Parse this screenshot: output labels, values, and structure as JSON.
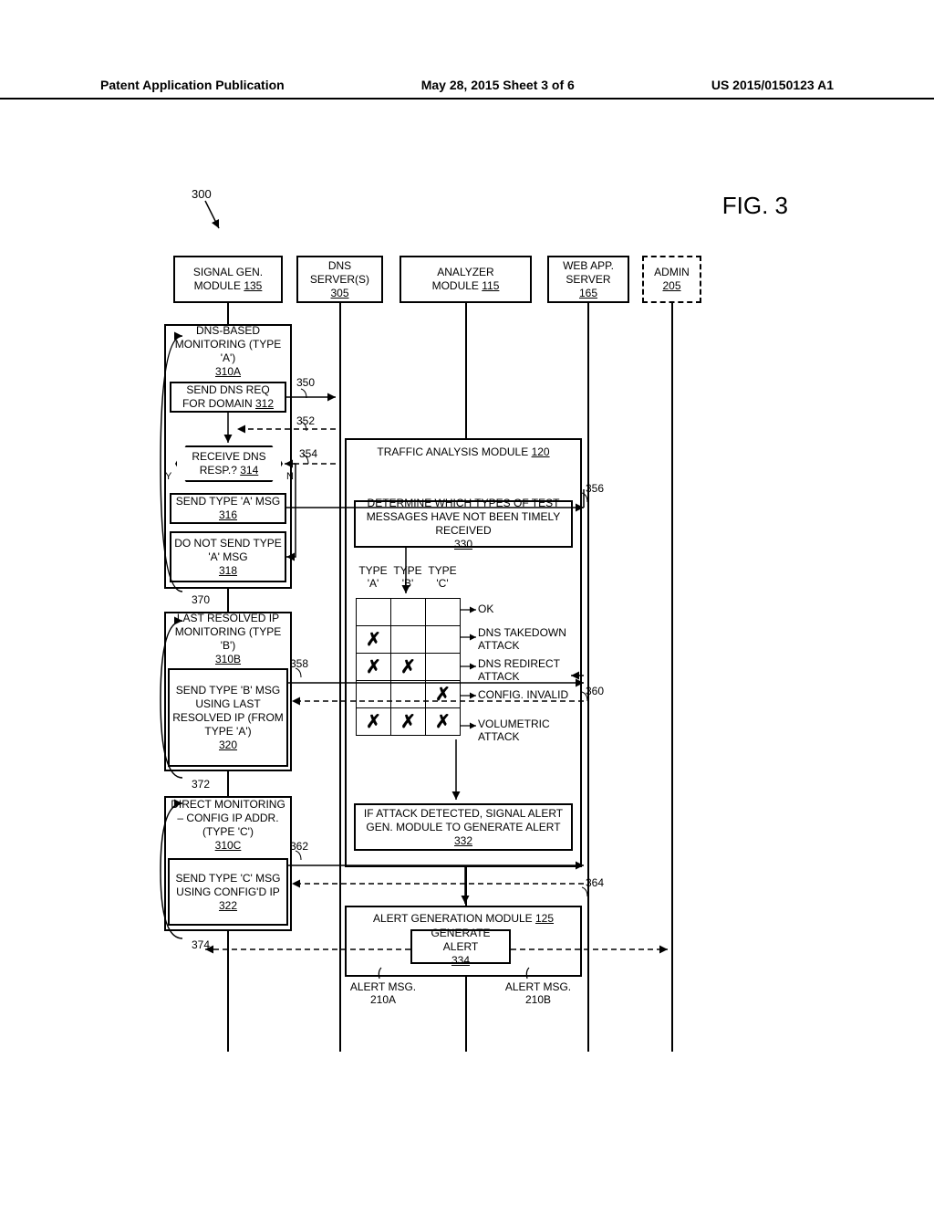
{
  "header": {
    "left": "Patent Application Publication",
    "mid": "May 28, 2015  Sheet 3 of 6",
    "right": "US 2015/0150123 A1"
  },
  "fig": "FIG. 3",
  "ref300": "300",
  "lanes": {
    "siggen": {
      "l1": "SIGNAL GEN.",
      "l2": "MODULE",
      "ref": "135"
    },
    "dns": {
      "l1": "DNS",
      "l2": "SERVER(S)",
      "ref": "305"
    },
    "analyzer": {
      "l1": "ANALYZER",
      "l2": "MODULE",
      "ref": "115"
    },
    "webapp": {
      "l1": "WEB APP.",
      "l2": "SERVER",
      "ref": "165"
    },
    "admin": {
      "l1": "ADMIN",
      "ref": "205"
    }
  },
  "typeA": {
    "title": "DNS-BASED MONITORING (TYPE 'A')",
    "title_ref": "310A",
    "send_req": "SEND DNS REQ FOR DOMAIN",
    "send_req_ref": "312",
    "receive": "RECEIVE DNS RESP.?",
    "receive_ref": "314",
    "y": "Y",
    "n": "N",
    "send_typeA": "SEND TYPE 'A' MSG",
    "send_typeA_ref": "316",
    "dont_send": "DO NOT SEND TYPE 'A' MSG",
    "dont_send_ref": "318",
    "loop_ref": "370"
  },
  "typeB": {
    "title": "LAST RESOLVED IP MONITORING (TYPE 'B')",
    "title_ref": "310B",
    "send": "SEND TYPE 'B' MSG USING LAST RESOLVED IP (FROM TYPE 'A')",
    "send_ref": "320",
    "loop_ref": "372"
  },
  "typeC": {
    "title": "DIRECT MONITORING – CONFIG IP ADDR. (TYPE 'C')",
    "title_ref": "310C",
    "send": "SEND TYPE 'C' MSG USING CONFIG'D IP",
    "send_ref": "322",
    "loop_ref": "374"
  },
  "tam": {
    "title": "TRAFFIC ANALYSIS MODULE",
    "title_ref": "120",
    "determine": "DETERMINE WHICH TYPES OF TEST MESSAGES HAVE NOT BEEN TIMELY RECEIVED",
    "determine_ref": "330",
    "hdrA": "TYPE 'A'",
    "hdrB": "TYPE 'B'",
    "hdrC": "TYPE 'C'",
    "rows": {
      "ok": {
        "a": false,
        "b": false,
        "c": false,
        "label": "OK"
      },
      "takedown": {
        "a": true,
        "b": false,
        "c": false,
        "label": "DNS TAKEDOWN ATTACK"
      },
      "redirect": {
        "a": true,
        "b": true,
        "c": false,
        "label": "DNS REDIRECT ATTACK"
      },
      "config": {
        "a": false,
        "b": false,
        "c": true,
        "label": "CONFIG. INVALID"
      },
      "volume": {
        "a": true,
        "b": true,
        "c": true,
        "label": "VOLUMETRIC ATTACK"
      }
    },
    "signal_alert": "IF ATTACK DETECTED, SIGNAL ALERT GEN. MODULE TO GENERATE ALERT",
    "signal_alert_ref": "332"
  },
  "agm": {
    "title": "ALERT GENERATION MODULE",
    "title_ref": "125",
    "gen": "GENERATE ALERT",
    "gen_ref": "334",
    "msgA": "ALERT MSG. 210A",
    "msgB": "ALERT MSG. 210B"
  },
  "arrow_refs": {
    "r350": "350",
    "r352": "352",
    "r354": "354",
    "r356": "356",
    "r358": "358",
    "r360": "360",
    "r362": "362",
    "r364": "364"
  }
}
